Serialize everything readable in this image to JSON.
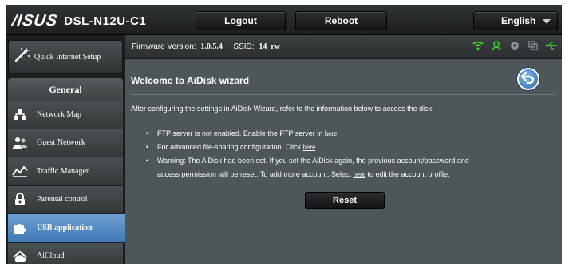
{
  "header": {
    "logo_text": "/ISUS",
    "model": "DSL-N12U-C1",
    "logout_label": "Logout",
    "reboot_label": "Reboot",
    "language_label": "English"
  },
  "status_bar": {
    "firmware_label": "Firmware Version:",
    "firmware_value": "1.0.5.4",
    "ssid_label": "SSID:",
    "ssid_value": "14_rw",
    "icons": [
      "wifi-icon",
      "user-icon",
      "cd-icon",
      "copy-icon",
      "usb-icon"
    ]
  },
  "sidebar": {
    "quick_setup_label": "Quick Internet Setup",
    "general_label": "General",
    "items": [
      {
        "label": "Network Map",
        "icon": "network-map-icon"
      },
      {
        "label": "Guest Network",
        "icon": "guest-network-icon"
      },
      {
        "label": "Traffic Manager",
        "icon": "traffic-manager-icon"
      },
      {
        "label": "Parental control",
        "icon": "parental-control-icon"
      },
      {
        "label": "USB application",
        "icon": "usb-application-icon",
        "active": true
      },
      {
        "label": "AiCloud",
        "icon": "aicloud-icon"
      }
    ]
  },
  "content": {
    "title": "Welcome to AiDisk wizard",
    "intro": "After configuring the settings in AiDisk Wizard, refer to the information below to access the disk:",
    "bullet1_text": "FTP server is not enabled. Enable the FTP server in",
    "bullet1_link": "here",
    "bullet1_end": ".",
    "bullet2_text": "For advanced file-sharing configuration. Click",
    "bullet2_link": "here",
    "bullet3_line1": "Warning: The AiDisk had been set. If you set the AiDisk again, the previous account/password and",
    "bullet3_line2": "access permission will be reset. To add more account, Select",
    "bullet3_link": "here",
    "bullet3_end": "to edit the account profile.",
    "reset_label": "Reset"
  },
  "colors": {
    "accent_blue": "#4f86c0",
    "main_bg": "#4f5659",
    "header_bg": "#1f2325",
    "wifi_green": "#3ddc2a"
  }
}
